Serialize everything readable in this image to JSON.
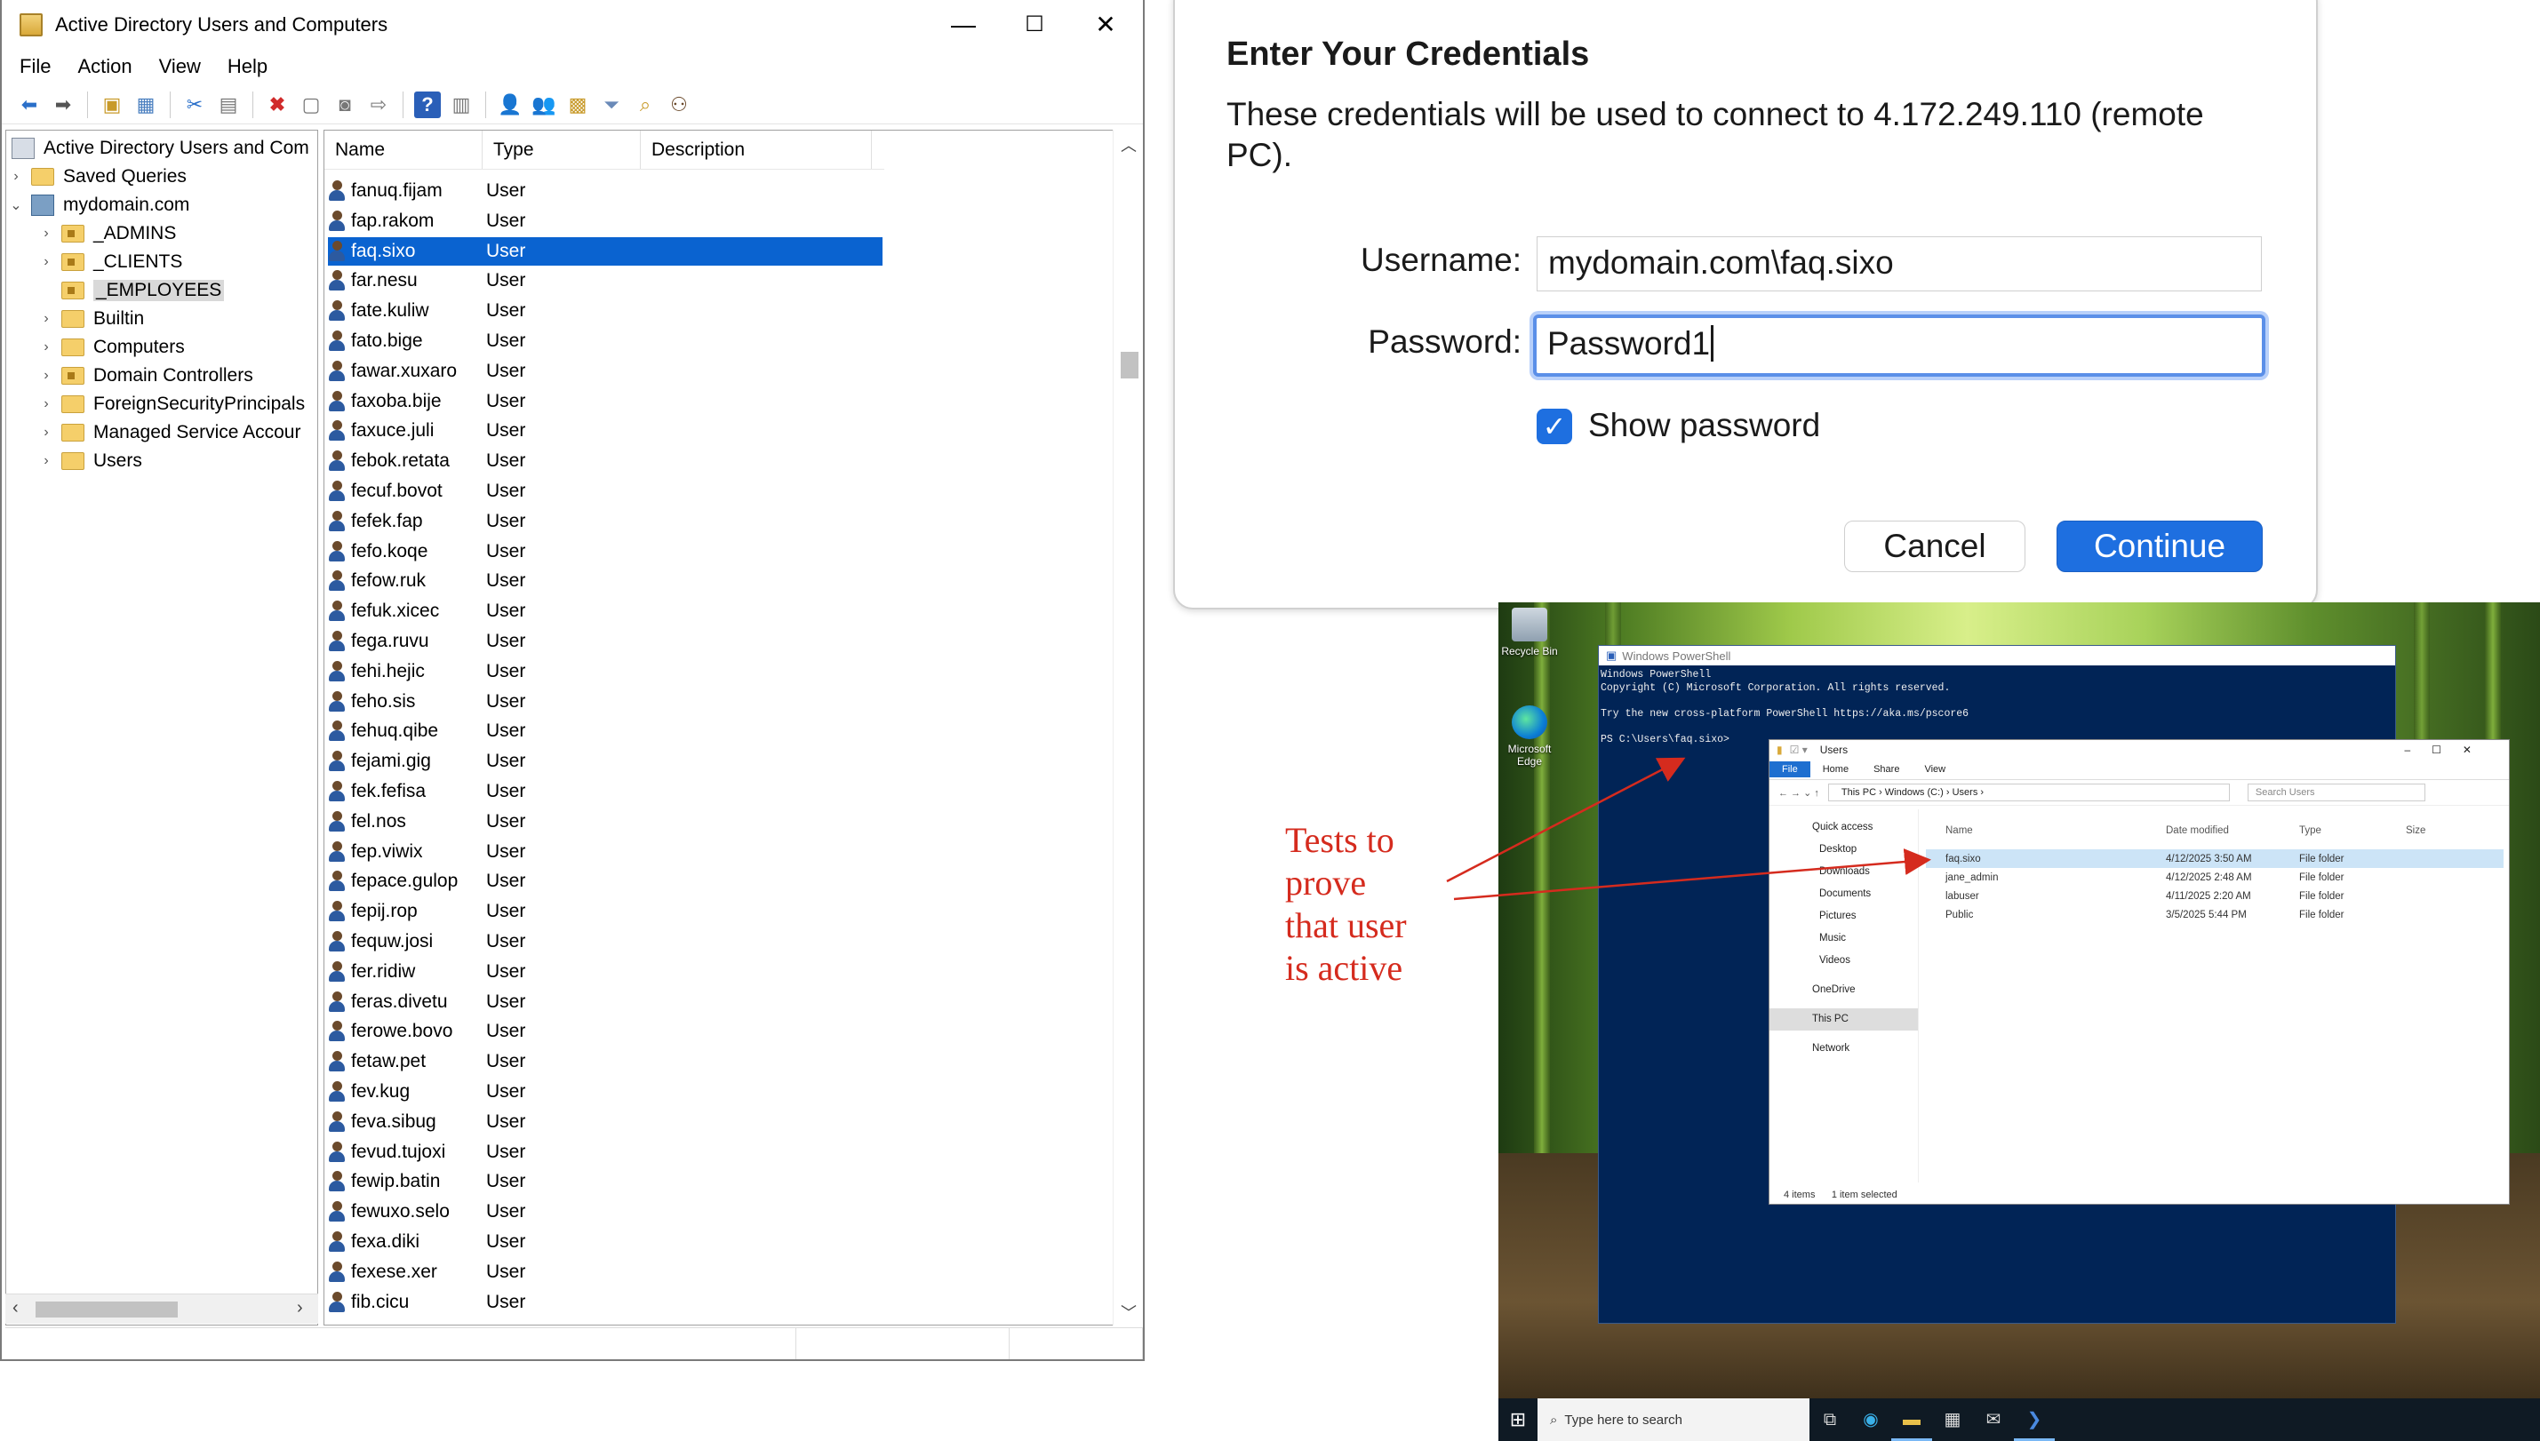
{
  "ad_window": {
    "title": "Active Directory Users and Computers",
    "controls": {
      "minimize": "—",
      "maximize": "☐",
      "close": "✕"
    },
    "menu": [
      "File",
      "Action",
      "View",
      "Help"
    ],
    "tree": {
      "root": "Active Directory Users and Com",
      "saved_queries": "Saved Queries",
      "domain": "mydomain.com",
      "children": [
        "_ADMINS",
        "_CLIENTS",
        "_EMPLOYEES",
        "Builtin",
        "Computers",
        "Domain Controllers",
        "ForeignSecurityPrincipals",
        "Managed Service Accour",
        "Users"
      ],
      "selected": "_EMPLOYEES"
    },
    "list": {
      "columns": [
        "Name",
        "Type",
        "Description"
      ],
      "type_value": "User",
      "selected": "faq.sixo",
      "names": [
        "fanuq.fijam",
        "fap.rakom",
        "faq.sixo",
        "far.nesu",
        "fate.kuliw",
        "fato.bige",
        "fawar.xuxaro",
        "faxoba.bije",
        "faxuce.juli",
        "febok.retata",
        "fecuf.bovot",
        "fefek.fap",
        "fefo.koqe",
        "fefow.ruk",
        "fefuk.xicec",
        "fega.ruvu",
        "fehi.hejic",
        "feho.sis",
        "fehuq.qibe",
        "fejami.gig",
        "fek.fefisa",
        "fel.nos",
        "fep.viwix",
        "fepace.gulop",
        "fepij.rop",
        "fequw.josi",
        "fer.ridiw",
        "feras.divetu",
        "ferowe.bovo",
        "fetaw.pet",
        "fev.kug",
        "feva.sibug",
        "fevud.tujoxi",
        "fewip.batin",
        "fewuxo.selo",
        "fexa.diki",
        "fexese.xer",
        "fib.cicu"
      ]
    }
  },
  "credentials_dialog": {
    "heading": "Enter Your Credentials",
    "message": "These credentials will be used to connect to 4.172.249.110 (remote PC).",
    "username_label": "Username:",
    "username_value": "mydomain.com\\faq.sixo",
    "password_label": "Password:",
    "password_value": "Password1",
    "show_password_label": "Show password",
    "show_password_checked": true,
    "cancel_label": "Cancel",
    "continue_label": "Continue",
    "accent_color": "#1e6fe0"
  },
  "remote_desktop": {
    "desktop_icons": [
      "Recycle Bin",
      "Microsoft Edge"
    ],
    "powershell": {
      "title": "Windows PowerShell",
      "lines": [
        "Windows PowerShell",
        "Copyright (C) Microsoft Corporation. All rights reserved.",
        "",
        "Try the new cross-platform PowerShell https://aka.ms/pscore6",
        "",
        "PS C:\\Users\\faq.sixo>"
      ]
    },
    "explorer": {
      "title": "Users",
      "ribbon": [
        "File",
        "Home",
        "Share",
        "View"
      ],
      "path": [
        "This PC",
        "Windows (C:)",
        "Users"
      ],
      "search_placeholder": "Search Users",
      "nav": [
        "Quick access",
        "Desktop",
        "Downloads",
        "Documents",
        "Pictures",
        "Music",
        "Videos",
        "OneDrive",
        "This PC",
        "Network"
      ],
      "columns": [
        "Name",
        "Date modified",
        "Type",
        "Size"
      ],
      "rows": [
        {
          "name": "faq.sixo",
          "date": "4/12/2025 3:50 AM",
          "type": "File folder"
        },
        {
          "name": "jane_admin",
          "date": "4/12/2025 2:48 AM",
          "type": "File folder"
        },
        {
          "name": "labuser",
          "date": "4/11/2025 2:20 AM",
          "type": "File folder"
        },
        {
          "name": "Public",
          "date": "3/5/2025 5:44 PM",
          "type": "File folder"
        }
      ],
      "status_items": "4 items",
      "status_selected": "1 item selected"
    },
    "taskbar_search": "Type here to search"
  },
  "annotation": {
    "text": [
      "Tests to",
      "prove",
      "that user",
      "is active"
    ],
    "color": "#d52b1e"
  }
}
